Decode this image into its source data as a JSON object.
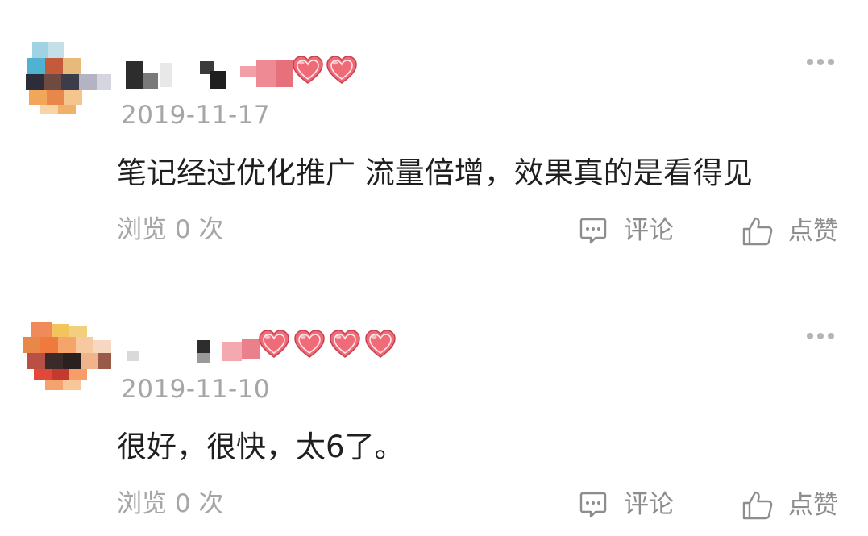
{
  "comments": [
    {
      "date": "2019-11-17",
      "content": "笔记经过优化推广 流量倍增，效果真的是看得见",
      "views": "浏览 0 次",
      "comment_label": "评论",
      "like_label": "点赞"
    },
    {
      "date": "2019-11-10",
      "content": "很好，很快，太6了。",
      "views": "浏览 0 次",
      "comment_label": "评论",
      "like_label": "点赞"
    }
  ],
  "icons": {
    "more": "more-dots-icon",
    "comment": "chat-bubble-icon",
    "like": "thumbs-up-icon",
    "emoji": "two-hearts-emoji"
  },
  "colors": {
    "muted_text": "#a6a6a6",
    "action_text": "#8d8d8d",
    "heart": "#e85a6a"
  }
}
